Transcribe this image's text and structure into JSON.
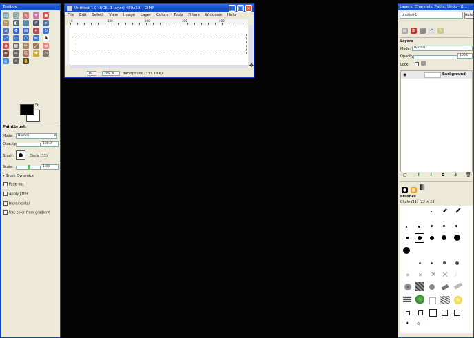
{
  "toolbox": {
    "title": "Toolbox",
    "tool_options_title": "Paintbrush",
    "mode_label": "Mode:",
    "mode_value": "Normal",
    "opacity_label": "Opacity:",
    "opacity_value": "100.0",
    "brush_label": "Brush:",
    "brush_value": "Circle (11)",
    "scale_label": "Scale:",
    "scale_value": "1.00",
    "brush_dynamics": "Brush Dynamics",
    "fade_out": "Fade out",
    "apply_jitter": "Apply Jitter",
    "incremental": "Incremental",
    "use_color_from_gradient": "Use color from gradient",
    "foreground_color": "#000000",
    "background_color": "#ffffff"
  },
  "image_window": {
    "title": "Untitled-1.0 (RGB, 1 layer) 480x50 – GIMP",
    "menus": [
      "File",
      "Edit",
      "Select",
      "View",
      "Image",
      "Layer",
      "Colors",
      "Tools",
      "Filters",
      "Windows",
      "Help"
    ],
    "ruler_ticks": [
      "0",
      "100",
      "200",
      "300",
      "400"
    ],
    "unit": "px",
    "zoom": "100 %",
    "status": "Background (337.3 KB)"
  },
  "layers_dock": {
    "title": "Layers, Channels, Paths, Undo - B...",
    "image_selector": "Untitled-1",
    "auto_button": "Auto",
    "panel_title": "Layers",
    "mode_label": "Mode:",
    "mode_value": "Normal",
    "opacity_label": "Opacity:",
    "opacity_value": "100.0",
    "lock_label": "Lock:",
    "layer_name": "Background"
  },
  "brushes_dock": {
    "panel_title": "Brushes",
    "brush_info": "Circle (11) (13 × 13)"
  },
  "colors": {
    "desktop": "#040404",
    "titlebar": "#0b49c8",
    "window_bg": "#ece9d8",
    "close": "#e04b22"
  }
}
